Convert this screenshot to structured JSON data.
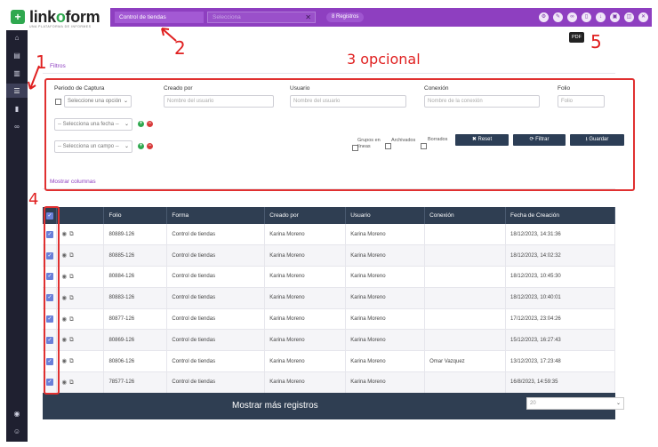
{
  "brand": {
    "plus": "+",
    "logo_left": "link",
    "logo_o": "o",
    "logo_right": "form",
    "tagline": "UNA PLATAFORMA DE INFORMES"
  },
  "topbar": {
    "form_select": "Control de tiendas",
    "search_placeholder": "Selecciona",
    "records_badge": "8 Registros",
    "icons": [
      "gear-icon",
      "pen-icon",
      "binoculars-icon",
      "pdf-icon",
      "download-icon",
      "export-icon",
      "upload-icon",
      "trash-icon"
    ],
    "tooltip": "PDF"
  },
  "annotations": {
    "one": "1",
    "two": "2",
    "three": "3 opcional",
    "four": "4",
    "five": "5"
  },
  "filters": {
    "link": "Filtros",
    "periodo_label": "Periodo de Captura",
    "periodo_select": "Seleccione una opción",
    "creado_label": "Creado por",
    "creado_placeholder": "Nombre del usuario",
    "usuario_label": "Usuario",
    "usuario_placeholder": "Nombre del usuario",
    "conexion_label": "Conexión",
    "conexion_placeholder": "Nombre de la conexión",
    "folio_label": "Folio",
    "folio_placeholder": "Folio",
    "fecha_select": "-- Selecciona una fecha --",
    "campo_select": "-- Selecciona un campo --",
    "grupos": "Grupos en líneas",
    "archivados": "Archivados",
    "borrados": "Borrados",
    "reset": "✖ Reset",
    "filtrar": "⟳ Filtrar",
    "guardar": "⭳ Guardar",
    "mostrar_columnas": "Mostrar columnas"
  },
  "table": {
    "headers": [
      "Folio",
      "Forma",
      "Creado por",
      "Usuario",
      "Conexión",
      "Fecha de Creación"
    ],
    "rows": [
      [
        "80889-126",
        "Control de tiendas",
        "Karina Moreno",
        "Karina Moreno",
        "",
        "18/12/2023, 14:31:36"
      ],
      [
        "80885-126",
        "Control de tiendas",
        "Karina Moreno",
        "Karina Moreno",
        "",
        "18/12/2023, 14:02:32"
      ],
      [
        "80884-126",
        "Control de tiendas",
        "Karina Moreno",
        "Karina Moreno",
        "",
        "18/12/2023, 10:45:30"
      ],
      [
        "80883-126",
        "Control de tiendas",
        "Karina Moreno",
        "Karina Moreno",
        "",
        "18/12/2023, 10:40:01"
      ],
      [
        "80877-126",
        "Control de tiendas",
        "Karina Moreno",
        "Karina Moreno",
        "",
        "17/12/2023, 23:04:26"
      ],
      [
        "80869-126",
        "Control de tiendas",
        "Karina Moreno",
        "Karina Moreno",
        "",
        "15/12/2023, 16:27:43"
      ],
      [
        "80806-126",
        "Control de tiendas",
        "Karina Moreno",
        "Karina Moreno",
        "Omar Vazquez",
        "13/12/2023, 17:23:48"
      ],
      [
        "78577-126",
        "Control de tiendas",
        "Karina Moreno",
        "Karina Moreno",
        "",
        "16/8/2023, 14:59:35"
      ]
    ]
  },
  "footer": {
    "more": "Mostrar más registros",
    "page_size": "20"
  }
}
